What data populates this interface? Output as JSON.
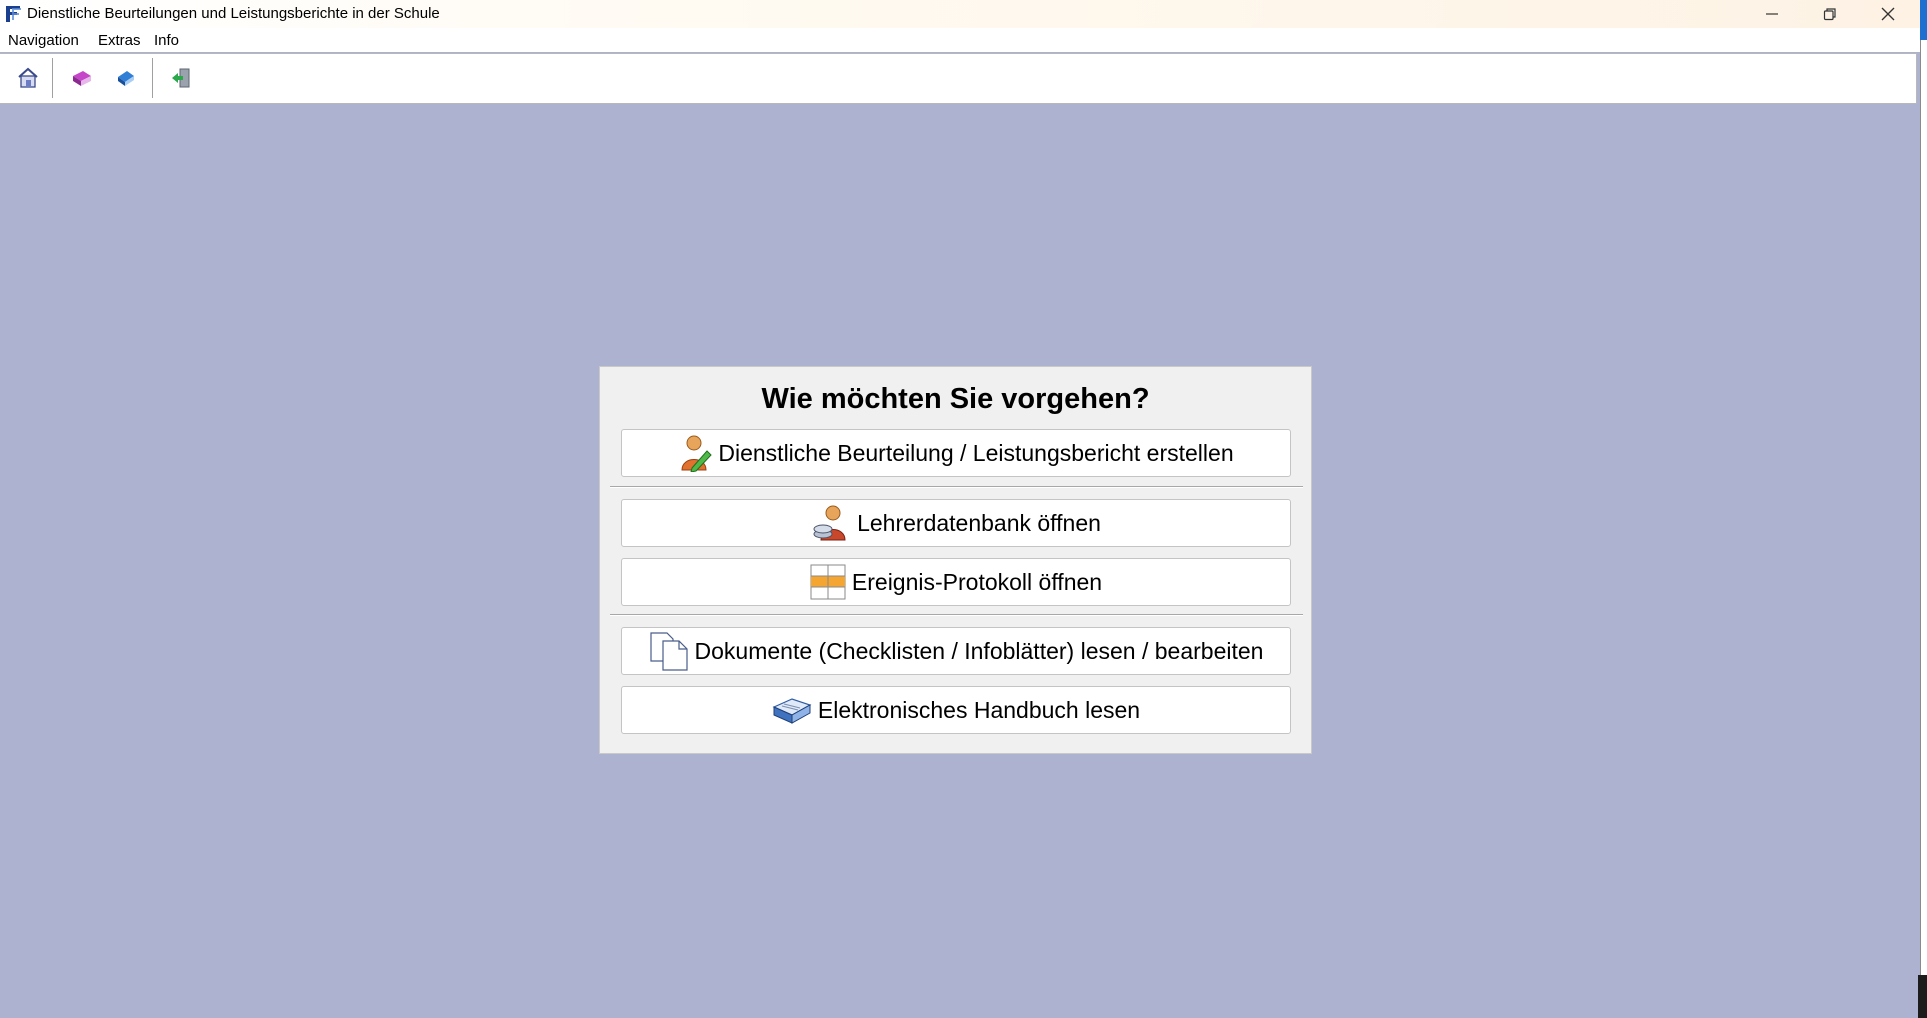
{
  "window": {
    "title": "Dienstliche Beurteilungen und Leistungsberichte in der Schule",
    "controls": [
      "minimize-icon",
      "restore-icon",
      "close-icon"
    ]
  },
  "menu": {
    "items": [
      {
        "label": "Navigation"
      },
      {
        "label": "Extras"
      },
      {
        "label": "Info"
      }
    ]
  },
  "toolbar": {
    "buttons": [
      "home-icon",
      "book-purple-icon",
      "book-blue-icon",
      "exit-icon"
    ]
  },
  "dialog": {
    "title": "Wie möchten Sie vorgehen?",
    "options": [
      {
        "label": "Dienstliche Beurteilung / Leistungsbericht erstellen",
        "icon": "person-edit-icon"
      },
      {
        "label": "Lehrerdatenbank öffnen",
        "icon": "person-database-icon"
      },
      {
        "label": "Ereignis-Protokoll öffnen",
        "icon": "table-icon"
      },
      {
        "label": "Dokumente (Checklisten / Infoblätter) lesen / bearbeiten",
        "icon": "documents-icon"
      },
      {
        "label": "Elektronisches Handbuch lesen",
        "icon": "open-book-icon"
      }
    ]
  },
  "colors": {
    "workspace": "#aeb2d1",
    "dialog_background": "#f0f0f0",
    "button_background": "#ffffff"
  }
}
